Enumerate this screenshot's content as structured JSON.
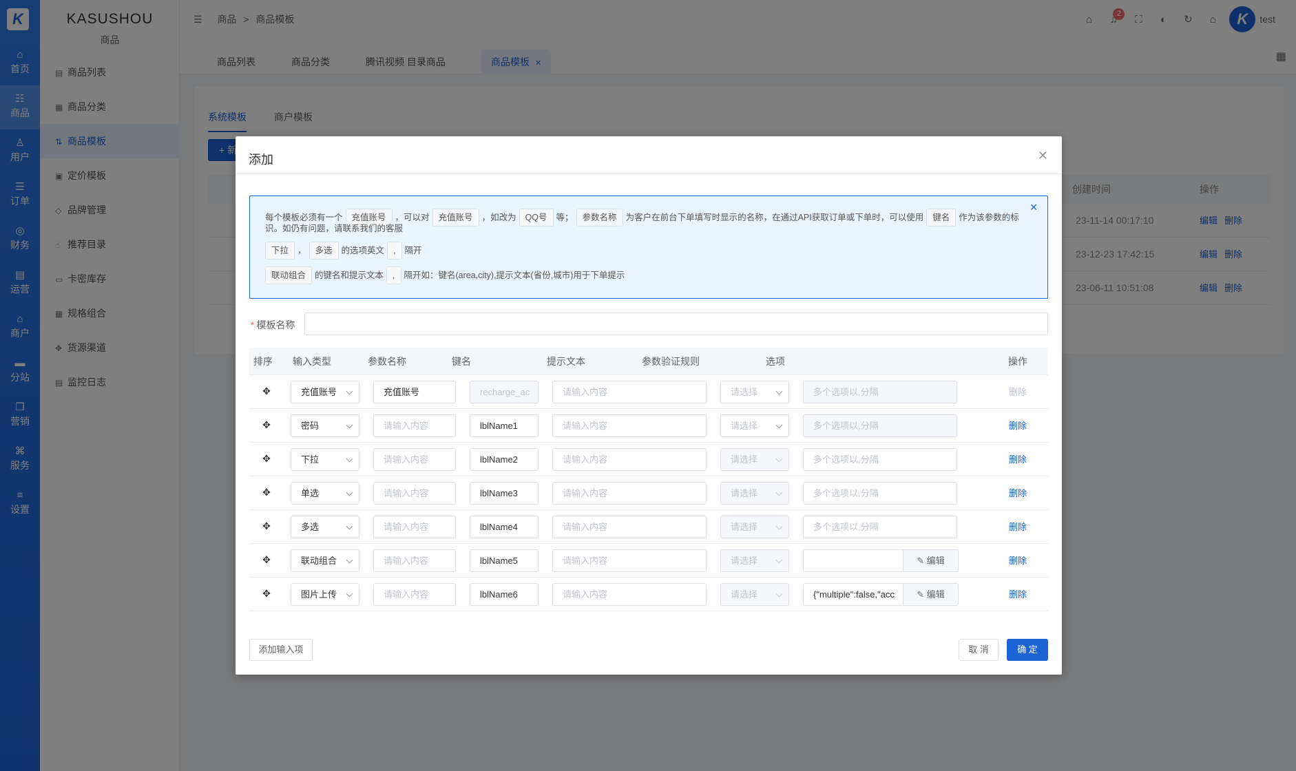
{
  "app": {
    "logo": "K",
    "brand": "KASUSHOU",
    "brand_sub": "商品"
  },
  "iconbar": [
    {
      "label": "首页",
      "icon": "home-icon",
      "glyph": "⌂"
    },
    {
      "label": "商品",
      "icon": "box-icon",
      "glyph": "☷"
    },
    {
      "label": "用户",
      "icon": "user-icon",
      "glyph": "♙"
    },
    {
      "label": "订单",
      "icon": "order-icon",
      "glyph": "☰"
    },
    {
      "label": "财务",
      "icon": "finance-icon",
      "glyph": "◎"
    },
    {
      "label": "运营",
      "icon": "operation-icon",
      "glyph": "▤"
    },
    {
      "label": "商户",
      "icon": "merchant-icon",
      "glyph": "⌂"
    },
    {
      "label": "分站",
      "icon": "substation-icon",
      "glyph": "▬"
    },
    {
      "label": "营销",
      "icon": "gift-icon",
      "glyph": "❒"
    },
    {
      "label": "服务",
      "icon": "service-icon",
      "glyph": "⌘"
    },
    {
      "label": "设置",
      "icon": "settings-icon",
      "glyph": "≡"
    }
  ],
  "sidebar": [
    {
      "label": "商品列表",
      "glyph": "▤"
    },
    {
      "label": "商品分类",
      "glyph": "▦"
    },
    {
      "label": "商品模板",
      "glyph": "⇅"
    },
    {
      "label": "定价模板",
      "glyph": "▣"
    },
    {
      "label": "品牌管理",
      "glyph": "◇"
    },
    {
      "label": "推荐目录",
      "glyph": "☝"
    },
    {
      "label": "卡密库存",
      "glyph": "▭"
    },
    {
      "label": "规格组合",
      "glyph": "▦"
    },
    {
      "label": "货源渠道",
      "glyph": "✥"
    },
    {
      "label": "监控日志",
      "glyph": "▤"
    }
  ],
  "header": {
    "breadcrumb": [
      "商品",
      ">",
      "商品模板"
    ],
    "notification_count": "2",
    "username": "test"
  },
  "tabs": [
    {
      "label": "商品列表"
    },
    {
      "label": "商品分类"
    },
    {
      "label": "腾讯视频 目录商品"
    },
    {
      "label": "商品模板"
    }
  ],
  "page": {
    "subtabs": [
      "系统模板",
      "商户模板"
    ],
    "add_label": "+ 新",
    "col_created": "创建时间",
    "col_ops": "操作",
    "rows": [
      {
        "created": "23-11-14 00:17:10",
        "edit": "编辑",
        "del": "删除"
      },
      {
        "created": "23-12-23 17:42:15",
        "edit": "编辑",
        "del": "删除"
      },
      {
        "created": "23-06-11 10:51:08",
        "edit": "编辑",
        "del": "删除"
      }
    ]
  },
  "modal": {
    "title": "添加",
    "alert": {
      "l1_a": "每个模板必须有一个",
      "l1_tag1": "充值账号",
      "l1_b": "，可以对",
      "l1_tag2": "充值账号",
      "l1_c": "，如改为",
      "l1_tag3": "QQ号",
      "l1_d": "等；",
      "l1_tag4": "参数名称",
      "l1_e": "为客户在前台下单填写时显示的名称，在通过API获取订单或下单时，可以使用",
      "l1_tag5": "键名",
      "l1_f": "作为该参数的标",
      "l1_g": "识。如仍有问题，请联系我们的客服",
      "l2_tag1": "下拉",
      "l2_a": "，",
      "l2_tag2": "多选",
      "l2_b": "的选项英文",
      "l2_tag3": ",",
      "l2_c": "隔开",
      "l3_tag1": "联动组合",
      "l3_a": "的键名和提示文本",
      "l3_tag2": ",",
      "l3_b": "隔开如：键名(area,city),提示文本(省份,城市)用于下单提示"
    },
    "name_label": "模板名称",
    "table": {
      "headers": [
        "排序",
        "输入类型",
        "参数名称",
        "键名",
        "提示文本",
        "参数验证规则",
        "选项",
        "操作"
      ],
      "rows": [
        {
          "type": "充值账号",
          "name": "充值账号",
          "key": "recharge_ac",
          "hint": "请输入内容",
          "rule": "请选择",
          "option": "多个选项以,分隔",
          "op": "删除"
        },
        {
          "type": "密码",
          "name": "请输入内容",
          "key": "lblName1",
          "hint": "请输入内容",
          "rule": "请选择",
          "option": "多个选项以,分隔",
          "op": "删除"
        },
        {
          "type": "下拉",
          "name": "请输入内容",
          "key": "lblName2",
          "hint": "请输入内容",
          "rule": "请选择",
          "option": "多个选项以,分隔",
          "op": "删除"
        },
        {
          "type": "单选",
          "name": "请输入内容",
          "key": "lblName3",
          "hint": "请输入内容",
          "rule": "请选择",
          "option": "多个选项以,分隔",
          "op": "删除"
        },
        {
          "type": "多选",
          "name": "请输入内容",
          "key": "lblName4",
          "hint": "请输入内容",
          "rule": "请选择",
          "option": "多个选项以,分隔",
          "op": "删除"
        },
        {
          "type": "联动组合",
          "name": "请输入内容",
          "key": "lblName5",
          "hint": "请输入内容",
          "rule": "请选择",
          "option": "",
          "edit": "编辑",
          "op": "删除"
        },
        {
          "type": "图片上传",
          "name": "请输入内容",
          "key": "lblName6",
          "hint": "请输入内容",
          "rule": "请选择",
          "option": "{\"multiple\":false,\"acc",
          "edit": "编辑",
          "op": "删除"
        }
      ]
    },
    "add_input": "添加输入项",
    "cancel": "取 消",
    "confirm": "确 定"
  }
}
